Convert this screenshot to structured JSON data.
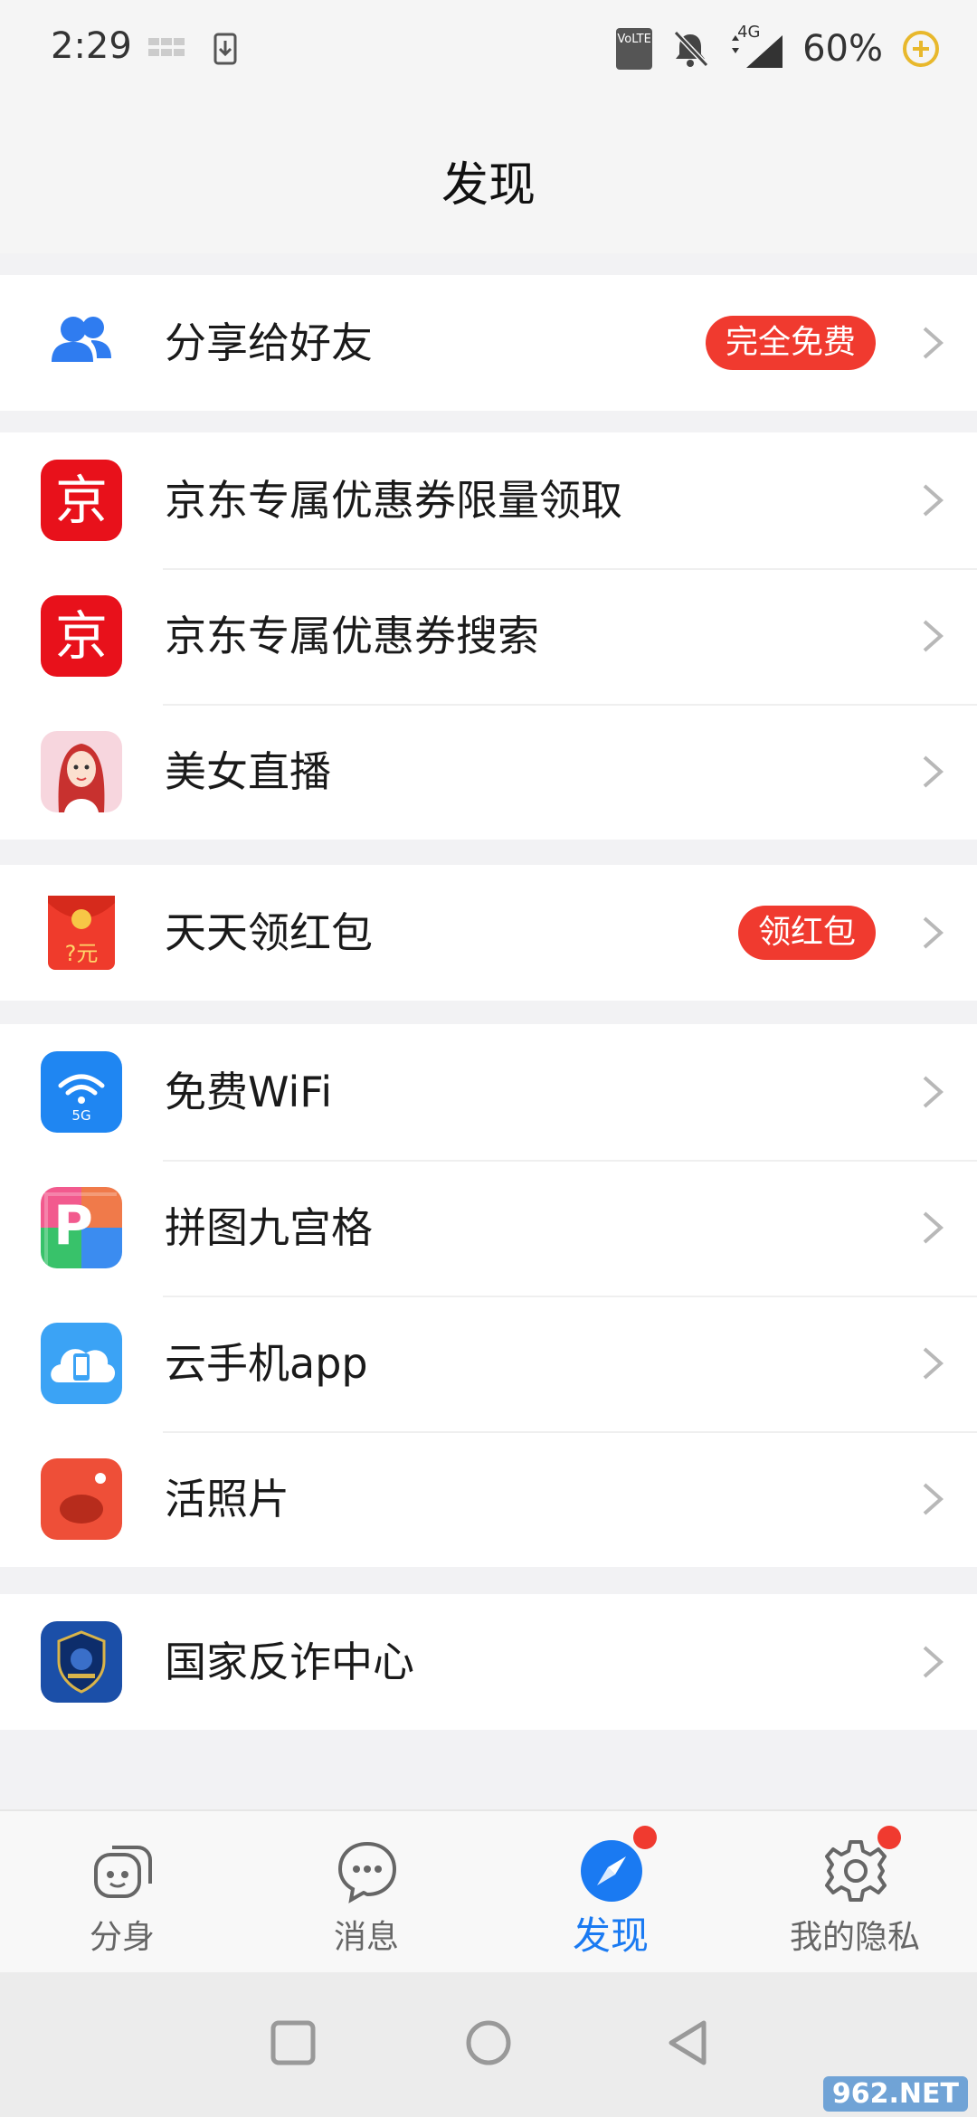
{
  "status_bar": {
    "time": "2:29",
    "battery_percent": "60%",
    "network": "4G",
    "volte": "VoLTE"
  },
  "header": {
    "title": "发现"
  },
  "sections": [
    {
      "items": [
        {
          "label": "分享给好友",
          "badge": "完全免费",
          "icon": "friends-icon"
        }
      ]
    },
    {
      "items": [
        {
          "label": "京东专属优惠券限量领取",
          "icon": "jd-icon",
          "icon_text": "京"
        },
        {
          "label": "京东专属优惠券搜索",
          "icon": "jd-icon",
          "icon_text": "京"
        },
        {
          "label": "美女直播",
          "icon": "live-stream-icon"
        }
      ]
    },
    {
      "items": [
        {
          "label": "天天领红包",
          "badge": "领红包",
          "icon": "red-packet-icon",
          "icon_text": "?元"
        }
      ]
    },
    {
      "items": [
        {
          "label": "免费WiFi",
          "icon": "wifi-icon",
          "icon_text": "5G"
        },
        {
          "label": "拼图九宫格",
          "icon": "puzzle-grid-icon",
          "icon_text": "P"
        },
        {
          "label": "云手机app",
          "icon": "cloud-phone-icon"
        },
        {
          "label": "活照片",
          "icon": "live-photo-icon"
        }
      ]
    },
    {
      "items": [
        {
          "label": "国家反诈中心",
          "icon": "anti-fraud-icon"
        }
      ]
    }
  ],
  "bottom_nav": {
    "items": [
      {
        "label": "分身",
        "icon": "clone-icon",
        "active": false
      },
      {
        "label": "消息",
        "icon": "message-icon",
        "active": false
      },
      {
        "label": "发现",
        "icon": "compass-icon",
        "active": true
      },
      {
        "label": "我的隐私",
        "icon": "settings-gear-icon",
        "active": false
      }
    ]
  },
  "watermark": "962.NET",
  "colors": {
    "accent": "#1a7af2",
    "badge": "#f03a2f",
    "background": "#f2f2f4"
  }
}
